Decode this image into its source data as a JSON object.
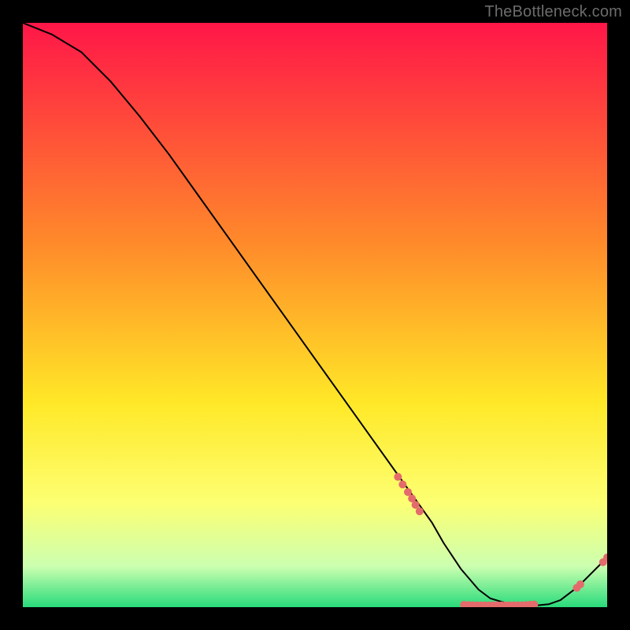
{
  "watermark": "TheBottleneck.com",
  "colors": {
    "gradient_top": "#ff1648",
    "gradient_mid1": "#ff8b2a",
    "gradient_mid2": "#ffe827",
    "gradient_mid3": "#fdff72",
    "gradient_mid4": "#ccffb0",
    "gradient_bottom": "#28db7b",
    "curve": "#000000",
    "marker": "#e46b6b"
  },
  "chart_data": {
    "type": "line",
    "title": "",
    "xlabel": "",
    "ylabel": "",
    "xlim": [
      0,
      100
    ],
    "ylim": [
      0,
      100
    ],
    "curve": {
      "x": [
        0,
        5,
        10,
        15,
        20,
        25,
        30,
        35,
        40,
        45,
        50,
        55,
        60,
        65,
        70,
        72,
        75,
        78,
        80,
        83,
        86,
        88,
        90,
        92,
        95,
        100
      ],
      "y": [
        100,
        98,
        95,
        90,
        84,
        77.5,
        70.5,
        63.5,
        56.5,
        49.5,
        42.5,
        35.5,
        28.5,
        21.5,
        14.5,
        11,
        6.5,
        3,
        1.5,
        0.6,
        0.3,
        0.3,
        0.5,
        1.2,
        3.5,
        8.5
      ]
    },
    "markers": [
      {
        "x": 64.2,
        "y": 22.3
      },
      {
        "x": 65.0,
        "y": 21.0
      },
      {
        "x": 65.9,
        "y": 19.7
      },
      {
        "x": 66.6,
        "y": 18.6
      },
      {
        "x": 67.2,
        "y": 17.5
      },
      {
        "x": 67.9,
        "y": 16.4
      },
      {
        "x": 75.5,
        "y": 0.4
      },
      {
        "x": 76.3,
        "y": 0.35
      },
      {
        "x": 77.0,
        "y": 0.32
      },
      {
        "x": 77.7,
        "y": 0.3
      },
      {
        "x": 78.4,
        "y": 0.3
      },
      {
        "x": 79.1,
        "y": 0.3
      },
      {
        "x": 79.8,
        "y": 0.3
      },
      {
        "x": 80.5,
        "y": 0.3
      },
      {
        "x": 81.2,
        "y": 0.3
      },
      {
        "x": 81.9,
        "y": 0.3
      },
      {
        "x": 82.6,
        "y": 0.3
      },
      {
        "x": 83.3,
        "y": 0.3
      },
      {
        "x": 84.0,
        "y": 0.3
      },
      {
        "x": 84.7,
        "y": 0.3
      },
      {
        "x": 85.4,
        "y": 0.3
      },
      {
        "x": 86.1,
        "y": 0.35
      },
      {
        "x": 86.8,
        "y": 0.4
      },
      {
        "x": 87.5,
        "y": 0.45
      },
      {
        "x": 94.8,
        "y": 3.3
      },
      {
        "x": 95.4,
        "y": 3.9
      },
      {
        "x": 99.3,
        "y": 7.7
      },
      {
        "x": 100.0,
        "y": 8.5
      }
    ]
  }
}
